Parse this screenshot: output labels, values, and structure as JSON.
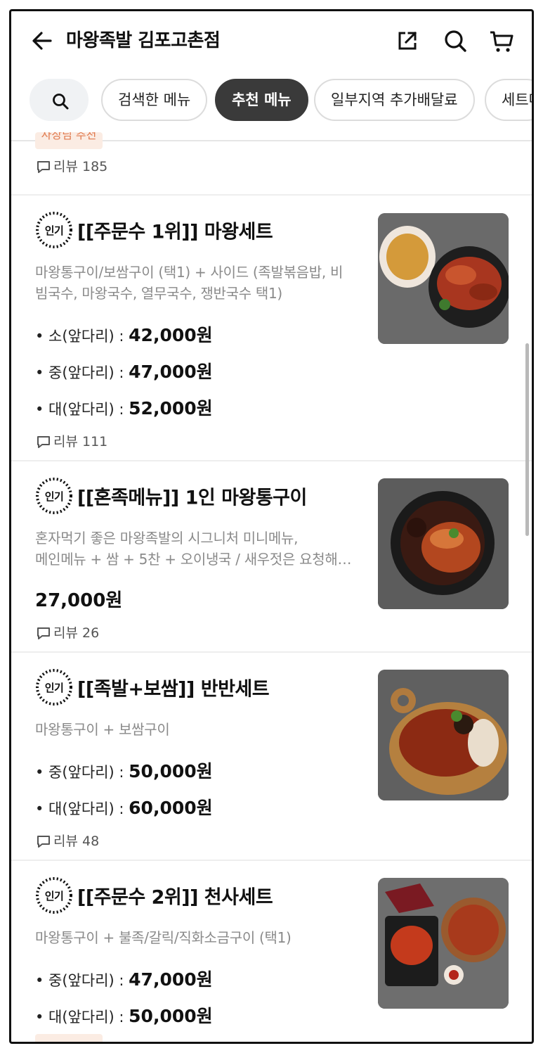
{
  "header": {
    "title": "마왕족발 김포고촌점"
  },
  "filters": [
    {
      "label": "검색한 메뉴",
      "active": false
    },
    {
      "label": "추천 메뉴",
      "active": true
    },
    {
      "label": "일부지역 추가배달료",
      "active": false
    },
    {
      "label": "세트메뉴",
      "active": false
    }
  ],
  "top_partial": {
    "badge": "사장님 추천",
    "review": "리뷰 185"
  },
  "items": [
    {
      "title": "[[주문수 1위]] 마왕세트",
      "desc_lines": [
        "마왕통구이/보쌈구이 (택1) + 사이드 (족발볶음밥, 비",
        "빔국수, 마왕국수, 열무국수, 쟁반국수 택1)"
      ],
      "options": [
        {
          "label": "• 소(앞다리) : ",
          "price": "42,000원"
        },
        {
          "label": "• 중(앞다리) : ",
          "price": "47,000원"
        },
        {
          "label": "• 대(앞다리) : ",
          "price": "52,000원"
        }
      ],
      "review": "리뷰 111",
      "image_icon": "food-photo-set"
    },
    {
      "title": "[[혼족메뉴]] 1인 마왕통구이",
      "desc_lines": [
        "혼자먹기 좋은 마왕족발의 시그니처 미니메뉴,",
        "메인메뉴 + 쌈 + 5찬 + 오이냉국 / 새우젓은 요청해…"
      ],
      "price": "27,000원",
      "review": "리뷰 26",
      "image_icon": "food-photo-single"
    },
    {
      "title": "[[족발+보쌈]] 반반세트",
      "desc_lines": [
        "마왕통구이 + 보쌈구이"
      ],
      "options": [
        {
          "label": "• 중(앞다리) : ",
          "price": "50,000원"
        },
        {
          "label": "• 대(앞다리) : ",
          "price": "60,000원"
        }
      ],
      "review": "리뷰 48",
      "image_icon": "food-photo-banban"
    },
    {
      "title": "[[주문수 2위]] 천사세트",
      "desc_lines": [
        "마왕통구이 + 불족/갈릭/직화소금구이 (택1)"
      ],
      "options": [
        {
          "label": "• 중(앞다리) : ",
          "price": "47,000원"
        },
        {
          "label": "• 대(앞다리) : ",
          "price": "50,000원"
        }
      ],
      "image_icon": "food-photo-angel"
    }
  ],
  "popular_badge": "인기"
}
